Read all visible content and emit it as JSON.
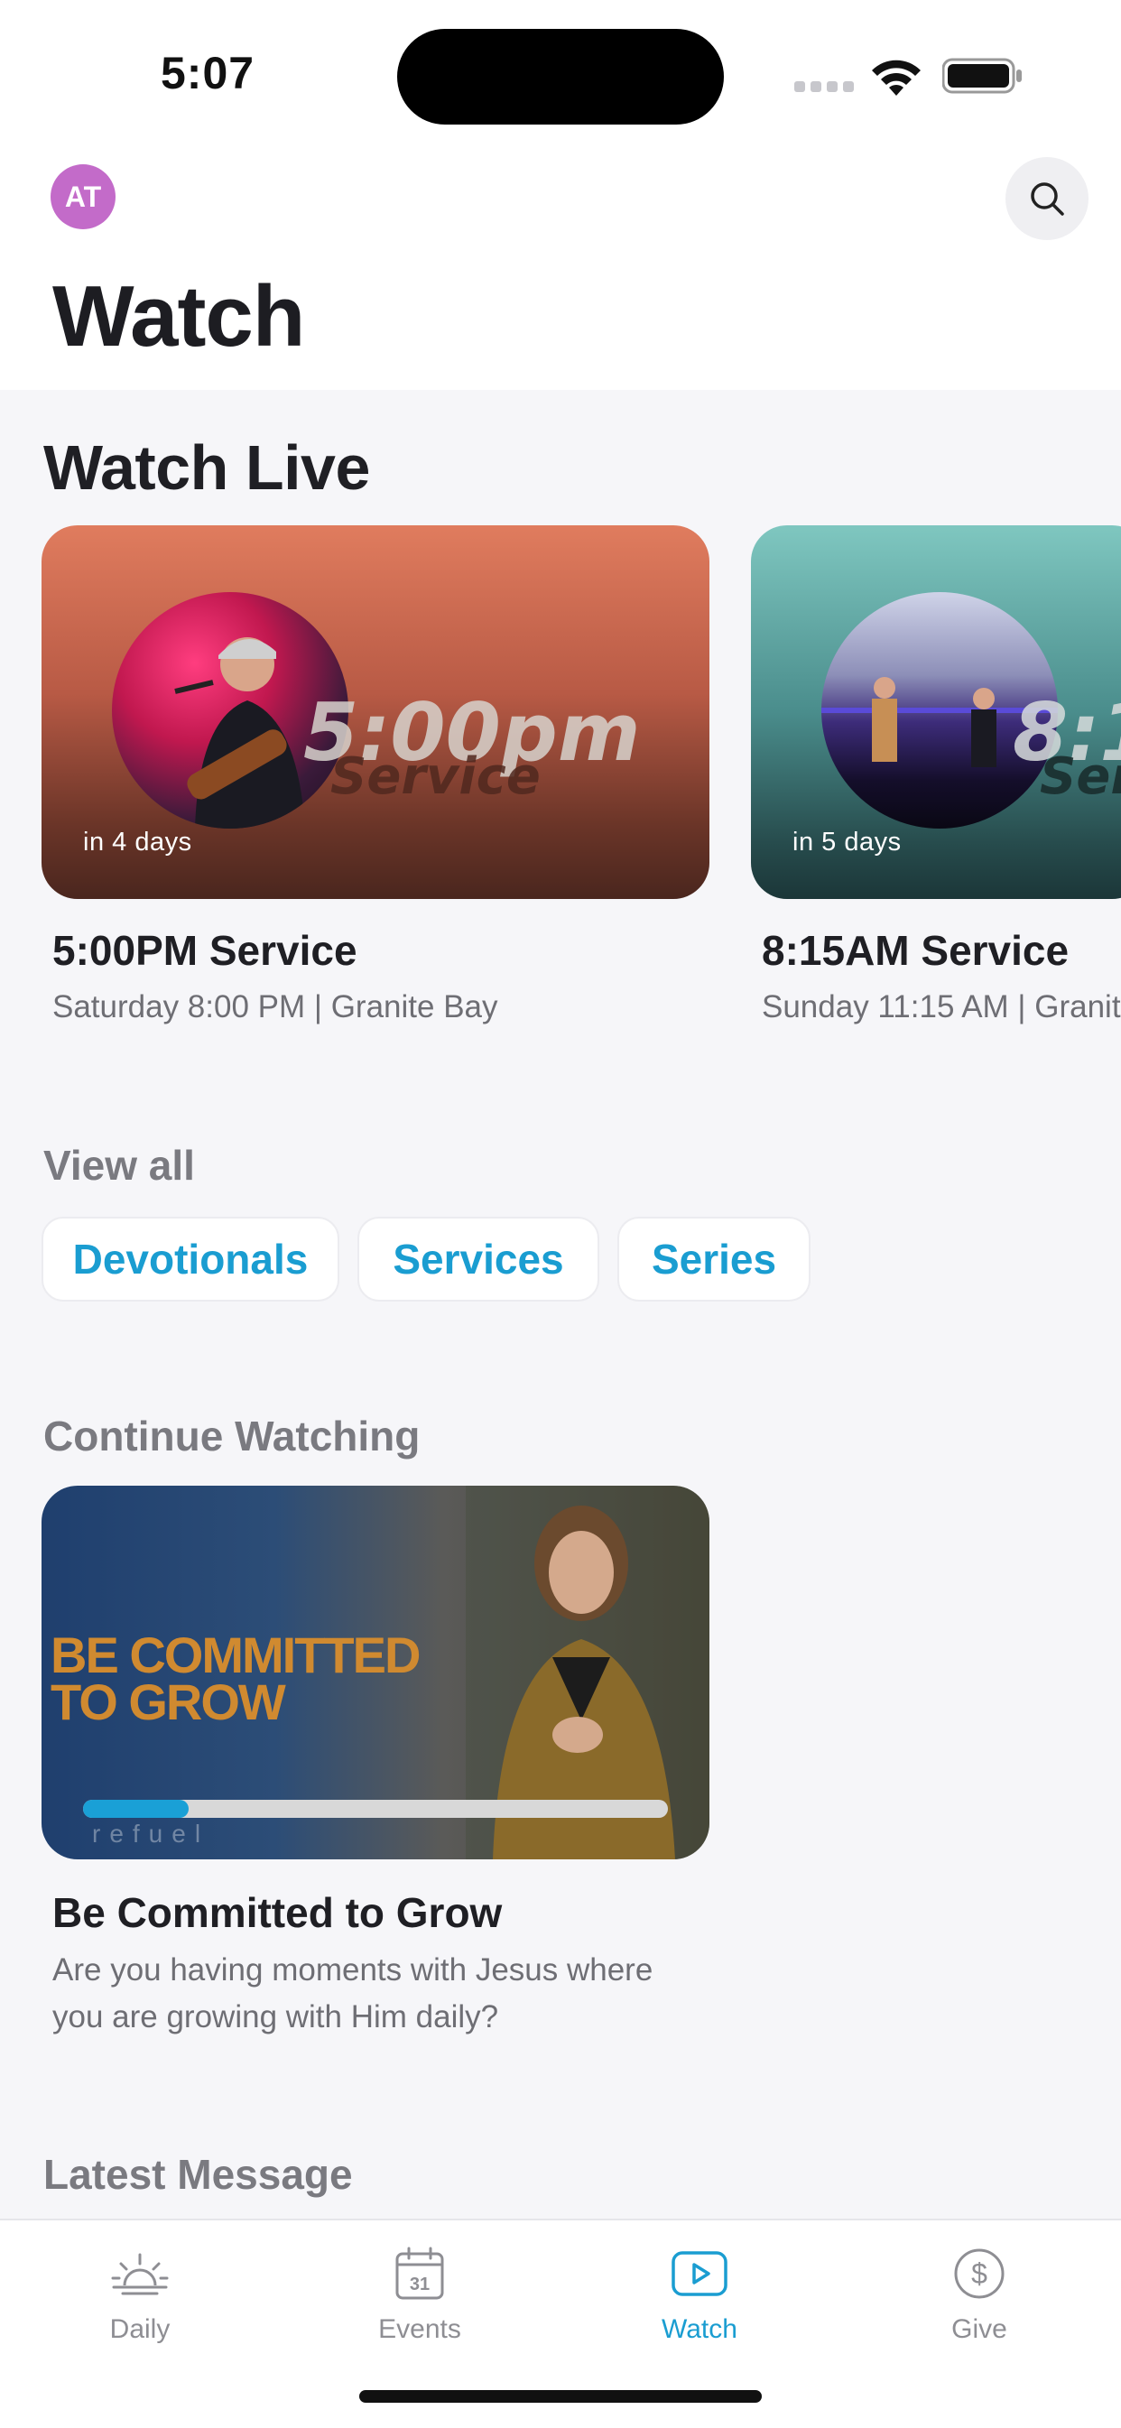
{
  "status_bar": {
    "time": "5:07"
  },
  "header": {
    "avatar_initials": "AT",
    "title": "Watch"
  },
  "watch_live": {
    "heading": "Watch Live",
    "cards": [
      {
        "badge": "in 4 days",
        "title": "5:00PM Service",
        "subtitle": "Saturday 8:00 PM | Granite Bay",
        "thumb_text_main": "5:00pm",
        "thumb_text_sub": "Service"
      },
      {
        "badge": "in 5 days",
        "title": "8:15AM Service",
        "subtitle": "Sunday 11:15 AM | Granit",
        "thumb_text_main": "8:1",
        "thumb_text_sub": "Ser"
      }
    ]
  },
  "view_all": {
    "heading": "View all",
    "chips": [
      "Devotionals",
      "Services",
      "Series"
    ]
  },
  "continue_watching": {
    "heading": "Continue Watching",
    "item": {
      "thumb_text_line1": "BE COMMITTED",
      "thumb_text_line2": "TO GROW",
      "thumb_logo": "refuel",
      "progress_fraction": 0.18,
      "title": "Be Committed to Grow",
      "description_line1": "Are you having moments with Jesus where",
      "description_line2": "you are growing with Him daily?"
    }
  },
  "latest_message": {
    "heading": "Latest Message"
  },
  "tab_bar": {
    "items": [
      {
        "label": "Daily",
        "icon": "sunrise-icon"
      },
      {
        "label": "Events",
        "icon": "calendar-icon",
        "icon_text": "31"
      },
      {
        "label": "Watch",
        "icon": "play-icon",
        "active": true
      },
      {
        "label": "Give",
        "icon": "dollar-circle-icon"
      }
    ]
  },
  "colors": {
    "accent": "#1a9dd1",
    "avatar": "#c36bc9"
  }
}
